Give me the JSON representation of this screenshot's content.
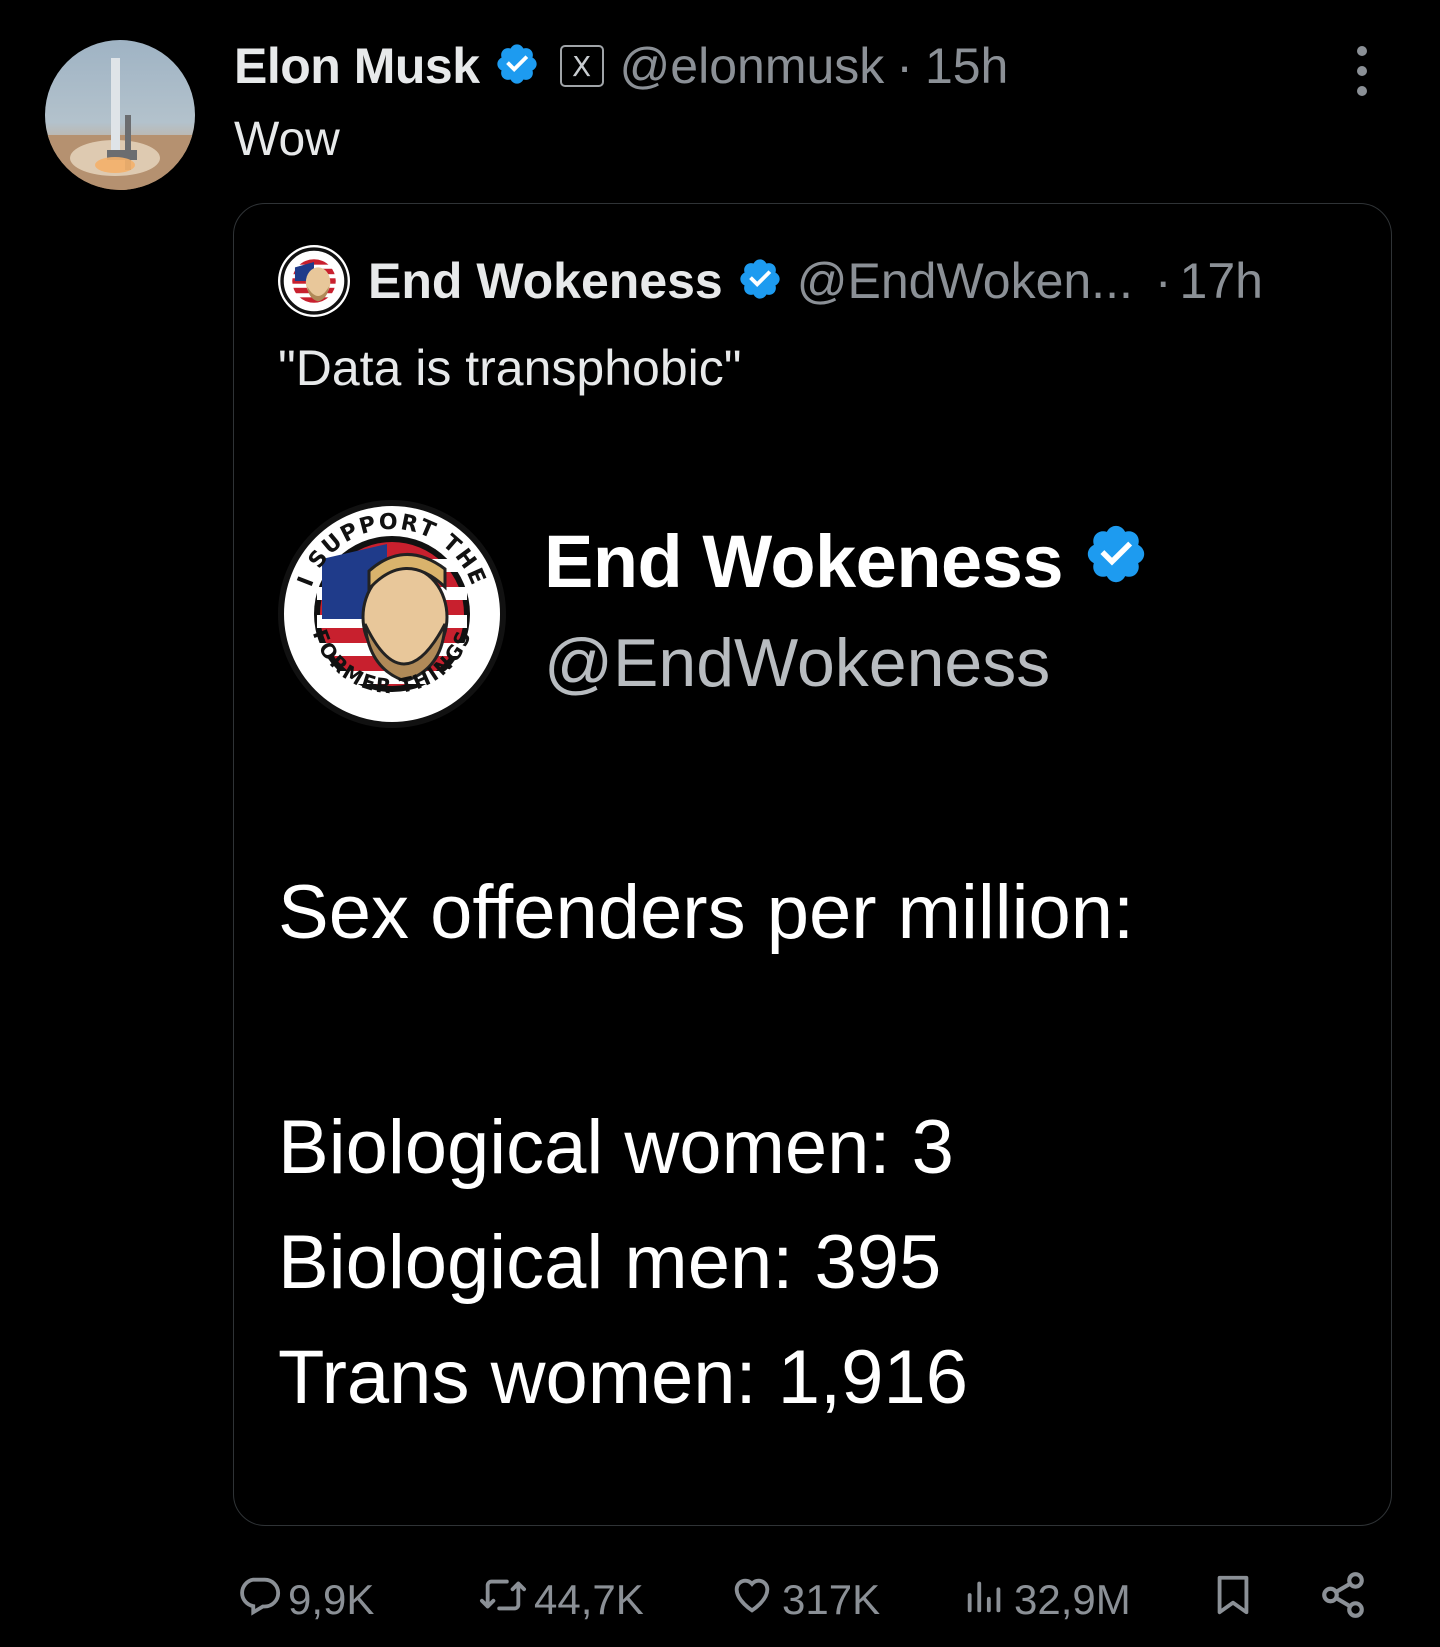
{
  "tweet": {
    "author_name": "Elon Musk",
    "author_handle": "@elonmusk",
    "separator": "·",
    "time": "15h",
    "affiliate_badge": "X",
    "text": "Wow"
  },
  "quoted": {
    "author_name": "End Wokeness",
    "author_handle": "@EndWoken...",
    "separator": "·",
    "time": "17h",
    "text": "\"Data is transphobic\"",
    "card": {
      "name": "End Wokeness",
      "handle": "@EndWokeness",
      "logo_top_text": "I SUPPORT THE",
      "logo_bottom_text": "FORMER THINGS",
      "title": "Sex offenders per million:",
      "lines": [
        "Biological women: 3",
        "Biological men: 395",
        "Trans women: 1,916"
      ]
    }
  },
  "actions": {
    "replies": "9,9K",
    "reposts": "44,7K",
    "likes": "317K",
    "views": "32,9M"
  },
  "icons": [
    "verified-icon",
    "x-affiliate-icon",
    "more-icon",
    "reply-icon",
    "repost-icon",
    "like-icon",
    "views-icon",
    "bookmark-icon",
    "share-icon"
  ],
  "colors": {
    "background": "#000000",
    "text": "#e7e9ea",
    "muted": "#8b9096",
    "verified": "#1d9bf0",
    "border": "#2f3336"
  }
}
